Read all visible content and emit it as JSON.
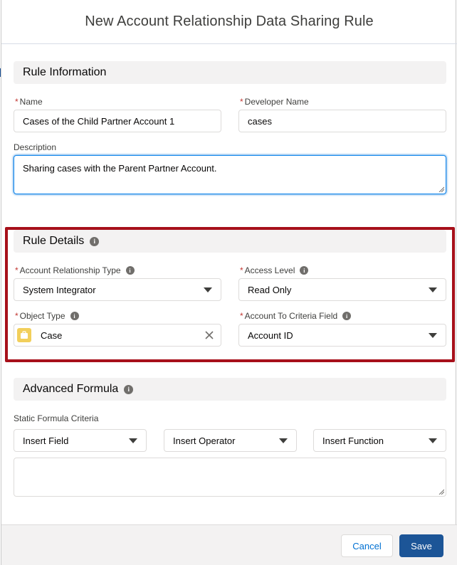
{
  "modal": {
    "title": "New Account Relationship Data Sharing Rule"
  },
  "rule_information": {
    "section_title": "Rule Information",
    "name_label": "Name",
    "name_value": "Cases of the Child Partner Account 1",
    "developer_name_label": "Developer Name",
    "developer_name_value": "cases",
    "description_label": "Description",
    "description_value": "Sharing cases with the Parent Partner Account."
  },
  "rule_details": {
    "section_title": "Rule Details",
    "account_relationship_type_label": "Account Relationship Type",
    "account_relationship_type_value": "System Integrator",
    "access_level_label": "Access Level",
    "access_level_value": "Read Only",
    "object_type_label": "Object Type",
    "object_type_value": "Case",
    "account_to_criteria_field_label": "Account To Criteria Field",
    "account_to_criteria_field_value": "Account ID"
  },
  "advanced_formula": {
    "section_title": "Advanced Formula",
    "static_formula_label": "Static Formula Criteria",
    "insert_field": "Insert Field",
    "insert_operator": "Insert Operator",
    "insert_function": "Insert Function",
    "formula_value": ""
  },
  "footer": {
    "cancel_label": "Cancel",
    "save_label": "Save"
  },
  "colors": {
    "brand_button": "#1c5597",
    "required_asterisk": "#c23934",
    "highlight_border": "#a7101a",
    "focus_border": "#1589ee"
  }
}
